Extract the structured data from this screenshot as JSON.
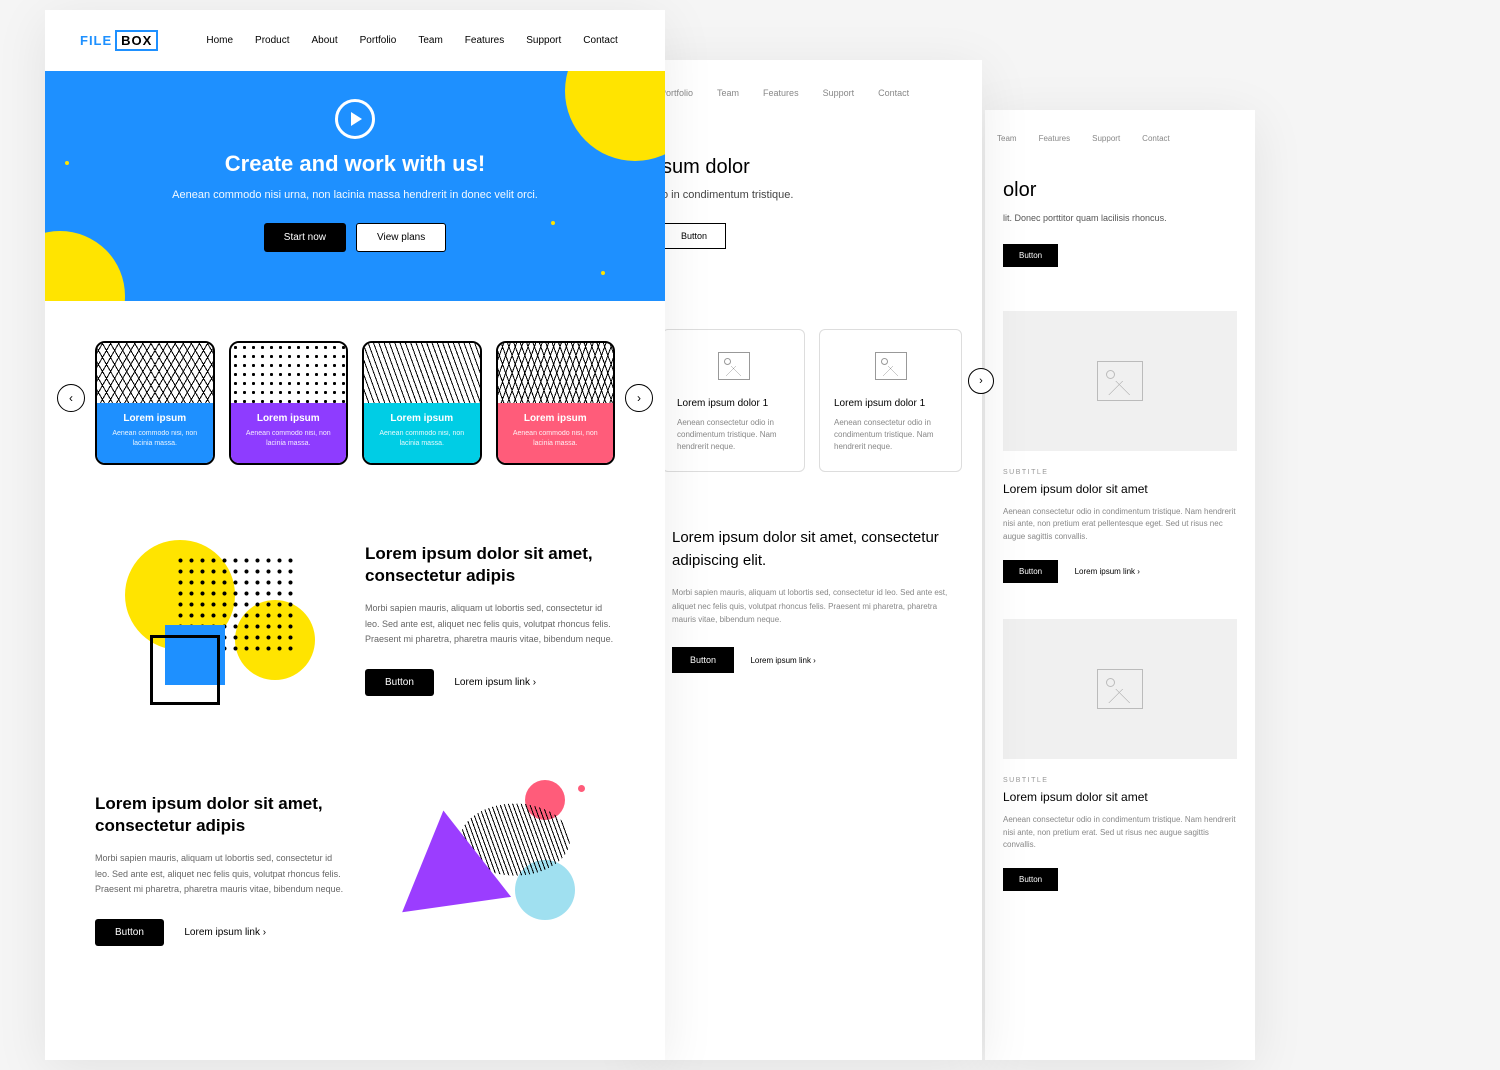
{
  "screen1": {
    "logo": {
      "part1": "FILE",
      "part2": "BOX"
    },
    "nav": [
      "Home",
      "Product",
      "About",
      "Portfolio",
      "Team",
      "Features",
      "Support",
      "Contact"
    ],
    "hero": {
      "title": "Create and work with us!",
      "subtitle": "Aenean commodo nisi urna, non lacinia massa hendrerit in donec velit orci.",
      "btn1": "Start now",
      "btn2": "View plans"
    },
    "cards": [
      {
        "title": "Lorem ipsum",
        "text": "Aenean commodo nisi, non lacinia massa."
      },
      {
        "title": "Lorem ipsum",
        "text": "Aenean commodo nisi, non lacinia massa."
      },
      {
        "title": "Lorem ipsum",
        "text": "Aenean commodo nisi, non lacinia massa."
      },
      {
        "title": "Lorem ipsum",
        "text": "Aenean commodo nisi, non lacinia massa."
      }
    ],
    "feature1": {
      "title": "Lorem ipsum dolor sit amet, consectetur adipis",
      "body": "Morbi sapien mauris, aliquam ut lobortis sed, consectetur id leo. Sed ante est, aliquet nec felis quis, volutpat rhoncus felis. Praesent mi pharetra, pharetra mauris vitae, bibendum neque.",
      "btn": "Button",
      "link": "Lorem ipsum link"
    },
    "feature2": {
      "title": "Lorem ipsum dolor sit amet, consectetur adipis",
      "body": "Morbi sapien mauris, aliquam ut lobortis sed, consectetur id leo. Sed ante est, aliquet nec felis quis, volutpat rhoncus felis. Praesent mi pharetra, pharetra mauris vitae, bibendum neque.",
      "btn": "Button",
      "link": "Lorem ipsum link"
    }
  },
  "screen2": {
    "nav": [
      "Portfolio",
      "Team",
      "Features",
      "Support",
      "Contact"
    ],
    "hero": {
      "title": "sum dolor",
      "subtitle": "o in condimentum tristique.",
      "btn": "Button"
    },
    "cards": [
      {
        "title": "Lorem ipsum dolor 1",
        "text": "Aenean consectetur odio in condimentum tristique. Nam hendrerit neque."
      },
      {
        "title": "Lorem ipsum dolor 1",
        "text": "Aenean consectetur odio in condimentum tristique. Nam hendrerit neque."
      }
    ],
    "section": {
      "title": "Lorem ipsum dolor sit amet, consectetur adipiscing elit.",
      "body": "Morbi sapien mauris, aliquam ut lobortis sed, consectetur id leo. Sed ante est, aliquet nec felis quis, volutpat rhoncus felis. Praesent mi pharetra, pharetra mauris vitae, bibendum neque.",
      "btn": "Button",
      "link": "Lorem ipsum link"
    }
  },
  "screen3": {
    "nav": [
      "Team",
      "Features",
      "Support",
      "Contact"
    ],
    "hero": {
      "title": "olor",
      "subtitle": "lit. Donec porttitor quam lacilisis rhoncus.",
      "btn": "Button"
    },
    "features": [
      {
        "subtitle": "SUBTITLE",
        "title": "Lorem ipsum dolor sit amet",
        "body": "Aenean consectetur odio in condimentum tristique. Nam hendrerit nisi ante, non pretium erat pellentesque eget. Sed ut risus nec augue sagittis convallis.",
        "btn": "Button",
        "link": "Lorem ipsum link"
      },
      {
        "subtitle": "SUBTITLE",
        "title": "Lorem ipsum dolor sit amet",
        "body": "Aenean consectetur odio in condimentum tristique. Nam hendrerit nisi ante, non pretium erat. Sed ut risus nec augue sagittis convallis.",
        "btn": "Button"
      }
    ]
  }
}
